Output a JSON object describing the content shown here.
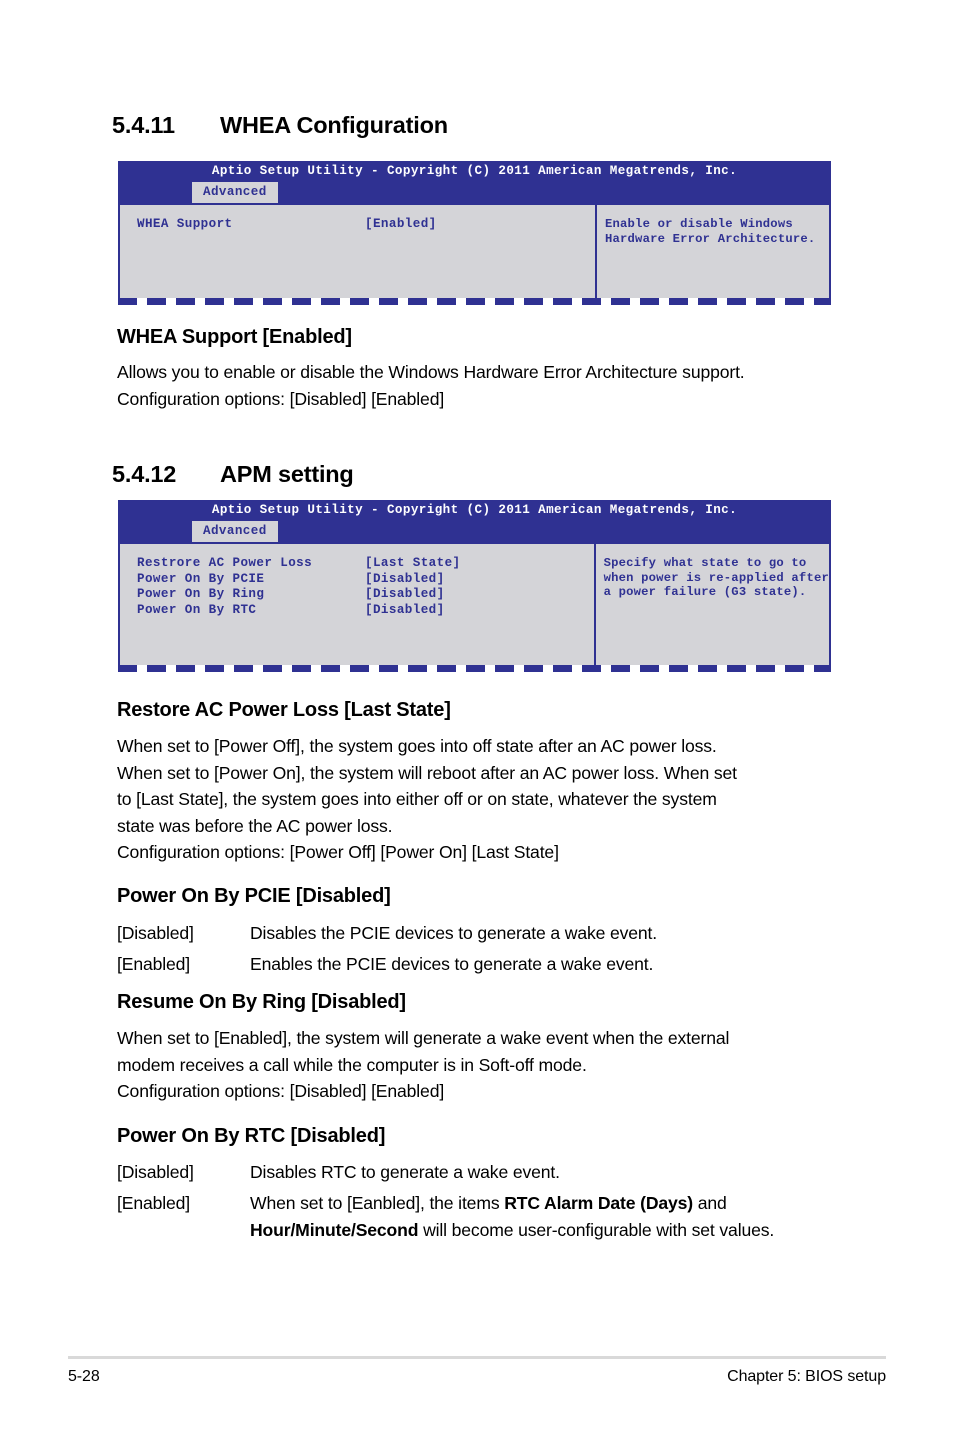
{
  "page": {
    "footer_page_number": "5-28",
    "footer_chapter": "Chapter 5: BIOS setup"
  },
  "sections": [
    {
      "number": "5.4.11",
      "title": "WHEA Configuration",
      "bios": {
        "title": "Aptio Setup Utility - Copyright (C) 2011 American Megatrends, Inc.",
        "tab": "Advanced",
        "items": [
          {
            "label": "WHEA Support",
            "value": "[Enabled]"
          }
        ],
        "help_lines": [
          "Enable or disable Windows",
          "Hardware Error Architecture."
        ]
      },
      "subsections": [
        {
          "heading": "WHEA Support [Enabled]",
          "paragraph_lines": [
            "Allows you to enable or disable the Windows Hardware Error Architecture support.",
            "Configuration options: [Disabled] [Enabled]"
          ]
        }
      ]
    },
    {
      "number": "5.4.12",
      "title": "APM setting",
      "bios": {
        "title": "Aptio Setup Utility - Copyright (C) 2011 American Megatrends, Inc.",
        "tab": "Advanced",
        "items": [
          {
            "label": "Restrore AC Power Loss",
            "value": "[Last State]"
          },
          {
            "label": "Power On By PCIE",
            "value": "[Disabled]"
          },
          {
            "label": "Power On By Ring",
            "value": "[Disabled]"
          },
          {
            "label": "Power On By RTC",
            "value": "[Disabled]"
          }
        ],
        "help_lines": [
          "Specify what state to go to",
          "when power is re-applied after",
          "a power failure (G3 state)."
        ]
      },
      "subsections": [
        {
          "heading": "Restore AC Power Loss [Last State]",
          "paragraph_lines": [
            "When set to [Power Off], the system goes into off state after an AC power loss.",
            "When set to [Power On], the system will reboot after an AC power loss. When set",
            "to [Last State], the system goes into either off or on state, whatever the system",
            "state was before the AC power loss.",
            "Configuration options: [Power Off] [Power On] [Last State]"
          ]
        },
        {
          "heading": "Power On By PCIE [Disabled]",
          "definitions": [
            {
              "term": "[Disabled]",
              "desc": "Disables the PCIE devices to generate a wake event."
            },
            {
              "term": "[Enabled]",
              "desc": "Enables the PCIE devices to generate a wake event."
            }
          ]
        },
        {
          "heading": "Resume On By Ring [Disabled]",
          "paragraph_lines": [
            "When set to [Enabled], the system will generate a wake event when the external",
            "modem receives a call while the computer is in Soft-off mode.",
            "Configuration options: [Disabled] [Enabled]"
          ]
        },
        {
          "heading": "Power On By RTC [Disabled]",
          "definitions": [
            {
              "term": "[Disabled]",
              "desc": "Disables RTC to generate a wake event."
            },
            {
              "term": "[Enabled]",
              "desc_parts": {
                "p1": "When set to [Eanbled], the items ",
                "b1": "RTC Alarm Date (Days)",
                "p2": " and ",
                "b2": "Hour/Minute/Second",
                "p3": " will become user-configurable with set values."
              }
            }
          ]
        }
      ]
    }
  ],
  "colors": {
    "bios_blue": "#2f3192",
    "bios_gray": "#d4d4d8",
    "footer_rule": "#d9d9d9"
  }
}
